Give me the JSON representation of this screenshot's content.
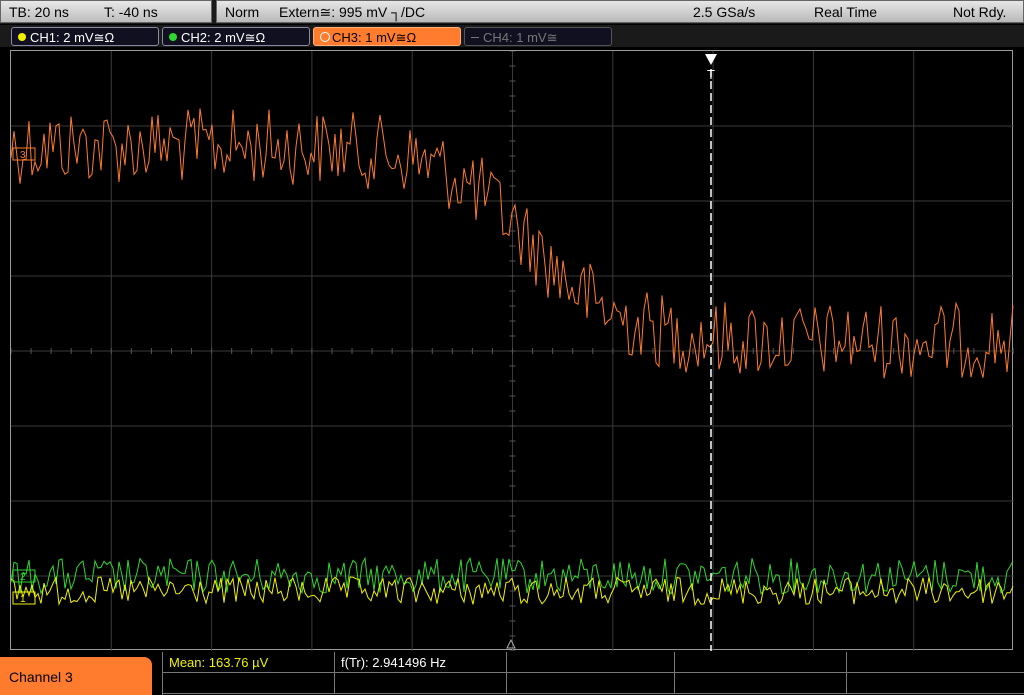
{
  "status_bar": {
    "timebase": "TB: 20 ns",
    "trigger_time": "T: -40 ns",
    "mode": "Norm",
    "trigger_source": "Extern≅: 995 mV ┐/DC",
    "sample_rate": "2.5 GSa/s",
    "acquisition": "Real Time",
    "state": "Not Rdy."
  },
  "channels": [
    {
      "label": "CH1: 2 mV≅Ω",
      "color": "#f2f200",
      "active": false,
      "enabled": true
    },
    {
      "label": "CH2: 2 mV≅Ω",
      "color": "#2fd82f",
      "active": false,
      "enabled": true
    },
    {
      "label": "CH3: 1 mV≅Ω",
      "color": "#ff7b2e",
      "active": true,
      "enabled": true
    },
    {
      "label": "CH4: 1 mV≅",
      "color": "#888888",
      "active": false,
      "enabled": false
    }
  ],
  "screen": {
    "trigger_marker": "T",
    "markers": {
      "ch3": "3",
      "ch2": "2",
      "ch1": "1"
    }
  },
  "bottom": {
    "channel_tab": "Channel 3",
    "measurements": {
      "mean": "Mean: 163.76 µV",
      "frequency": "f(Tr): 2.941496 Hz"
    }
  },
  "colors": {
    "ch1": "#f2f200",
    "ch2": "#2fd82f",
    "ch3": "#ff7b2e",
    "grid": "#3a3a3a",
    "trigger_line": "#ffffff"
  }
}
